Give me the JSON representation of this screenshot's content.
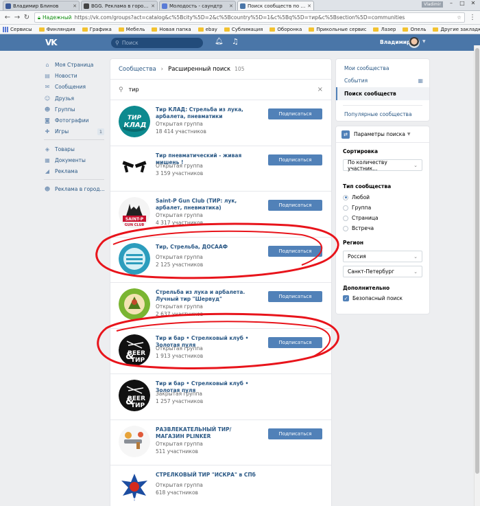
{
  "browser": {
    "tabs": [
      {
        "label": "Владимир Блинов",
        "icon_color": "#3b5998",
        "active": false
      },
      {
        "label": "BGG. Реклама в городе",
        "icon_color": "#444444",
        "active": false
      },
      {
        "label": "Молодость - саундтр",
        "icon_color": "#5a7bd6",
        "active": false
      },
      {
        "label": "Поиск сообществ по за",
        "icon_color": "#4a76a8",
        "active": true
      }
    ],
    "window_user": "Vladimir",
    "secure_label": "Надежный",
    "url": "https://vk.com/groups?act=catalog&c%5Bcity%5D=2&c%5Bcountry%5D=1&c%5Bq%5D=тир&c%5Bsection%5D=communities",
    "bookmarks": [
      "Сервисы",
      "Финляндия",
      "Графика",
      "Мебель",
      "Новая папка",
      "ebay",
      "Сублимация",
      "Оборонка",
      "Прикольные сервис",
      "Лазер",
      "Опель"
    ],
    "other_bookmarks": "Другие закладки"
  },
  "vk": {
    "logo": "VK",
    "search_placeholder": "Поиск",
    "user_name": "Владимир",
    "colors": {
      "header": "#4a76a8",
      "link": "#2a5885",
      "button": "#5181b8",
      "annotation": "#e8141b"
    }
  },
  "leftmenu": [
    {
      "icon": "home-icon",
      "glyph": "⌂",
      "label": "Моя Страница"
    },
    {
      "icon": "news-icon",
      "glyph": "▤",
      "label": "Новости"
    },
    {
      "icon": "messages-icon",
      "glyph": "✉",
      "label": "Сообщения"
    },
    {
      "icon": "friends-icon",
      "glyph": "☺",
      "label": "Друзья"
    },
    {
      "icon": "groups-icon",
      "glyph": "☻",
      "label": "Группы"
    },
    {
      "icon": "photos-icon",
      "glyph": "◙",
      "label": "Фотографии"
    },
    {
      "icon": "games-icon",
      "glyph": "✚",
      "label": "Игры",
      "count": "1"
    },
    {
      "icon": "goods-icon",
      "glyph": "◈",
      "label": "Товары"
    },
    {
      "icon": "documents-icon",
      "glyph": "▦",
      "label": "Документы"
    },
    {
      "icon": "ads-icon",
      "glyph": "◢",
      "label": "Реклама"
    },
    {
      "icon": "city-ads-icon",
      "glyph": "☻",
      "label": "Реклама в город..."
    }
  ],
  "main": {
    "crumb_section": "Сообщества",
    "crumb_page": "Расширенный поиск",
    "result_count": "105",
    "query": "тир",
    "subscribe_label": "Подписаться",
    "results": [
      {
        "title": "Тир КЛАД: Стрельба из лука, арбалета, пневматики",
        "type": "Открытая группа",
        "members": "18 414 участников",
        "avatar": "klad",
        "button": true
      },
      {
        "title": "Тир пневматический - живая мишень !",
        "type": "Открытая группа",
        "members": "3 159 участников",
        "avatar": "guns",
        "button": true
      },
      {
        "title": "Saint-P Gun Club (ТИР: лук, арбалет, пневматика)",
        "type": "Открытая группа",
        "members": "4 317 участников",
        "avatar": "saintp",
        "button": true
      },
      {
        "title": "Тир, Стрельба, ДОСААФ",
        "type": "Открытая группа",
        "members": "2 125 участников",
        "avatar": "dosaaf",
        "button": true
      },
      {
        "title": "Стрельба из лука и арбалета. Лучный тир \"Шервуд\"",
        "type": "Открытая группа",
        "members": "2 637 участников",
        "avatar": "sherwood",
        "button": true
      },
      {
        "title": "Тир и бар • Стрелковый клуб • Золотая пуля",
        "type": "Открытая группа",
        "members": "1 913 участников",
        "avatar": "beer",
        "button": true
      },
      {
        "title": "Тир и бар • Стрелковый клуб • Золотая пуля",
        "type": "Закрытая группа",
        "members": "1 257 участников",
        "avatar": "beer",
        "button": false
      },
      {
        "title": "РАЗВЛЕКАТЕЛЬНЫЙ ТИР/МАГАЗИН PLINKER",
        "type": "Открытая группа",
        "members": "511 участников",
        "avatar": "plinker",
        "button": true
      },
      {
        "title": "СТРЕЛКОВЫЙ ТИР \"ИСКРА\" в СПб",
        "type": "Открытая группа",
        "members": "618 участников",
        "avatar": "iskra",
        "button": false
      }
    ]
  },
  "right": {
    "nav": [
      "Мои сообщества",
      "События",
      "Поиск сообществ",
      "Популярные сообщества"
    ],
    "params_title": "Параметры поиска",
    "sort_label": "Сортировка",
    "sort_value": "По количеству участник...",
    "type_label": "Тип сообщества",
    "types": [
      "Любой",
      "Группа",
      "Страница",
      "Встреча"
    ],
    "region_label": "Регион",
    "country": "Россия",
    "city": "Санкт-Петербург",
    "extra_label": "Дополнительно",
    "safe_search": "Безопасный поиск"
  }
}
